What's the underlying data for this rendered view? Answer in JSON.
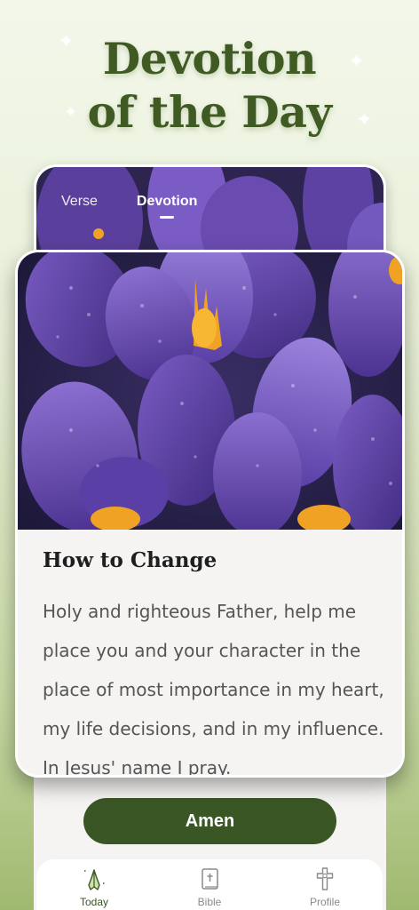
{
  "hero": {
    "title_line1": "Devotion",
    "title_line2": "of the Day"
  },
  "tabs": [
    {
      "label": "Verse",
      "active": false
    },
    {
      "label": "Devotion",
      "active": true
    }
  ],
  "devotion": {
    "title": "How to Change",
    "body": "Holy and righteous Father, help me place you and your character in the place of most importance in my heart, my life decisions, and in my influence. In Jesus' name I pray."
  },
  "actions": {
    "amen_label": "Amen"
  },
  "nav": {
    "items": [
      {
        "label": "Today",
        "icon": "praying-hands-icon",
        "active": true
      },
      {
        "label": "Bible",
        "icon": "bible-icon",
        "active": false
      },
      {
        "label": "Profile",
        "icon": "cross-icon",
        "active": false
      }
    ]
  },
  "colors": {
    "brand_green": "#3b5625",
    "title_green": "#3f5a23",
    "petal_purple": "#6a4bb0",
    "stamen_orange": "#f0a224"
  }
}
